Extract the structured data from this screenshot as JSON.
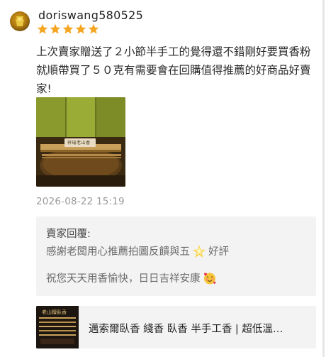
{
  "review": {
    "username": "doriswang580525",
    "rating": 5,
    "text": "上次賣家贈送了２小節半手工的覺得還不錯剛好要買香粉就順帶買了５０克有需要會在回購值得推薦的好商品好賣家!",
    "timestamp": "2026-08-22 15:19",
    "photo": {
      "plaque_text": "祥瑞老山香"
    }
  },
  "seller_reply": {
    "title": "賣家回覆:",
    "line1_before_emoji": "感謝老闆用心推薦拍圖反饋與五",
    "line1_emoji": "sparkle-star-icon",
    "line1_after_emoji": "好評",
    "line2_text": "祝您天天用香愉快，日日吉祥安康",
    "line2_emoji": "smiling-face-with-hearts-icon"
  },
  "product": {
    "title": "邁索爾臥香 綫香 臥香 半手工香 | 超低溫…",
    "thumb_text": "老山檀臥香"
  },
  "colors": {
    "star": "#f5a623",
    "reply_bg": "#f3f3f3",
    "timestamp": "#9a9a9a"
  }
}
